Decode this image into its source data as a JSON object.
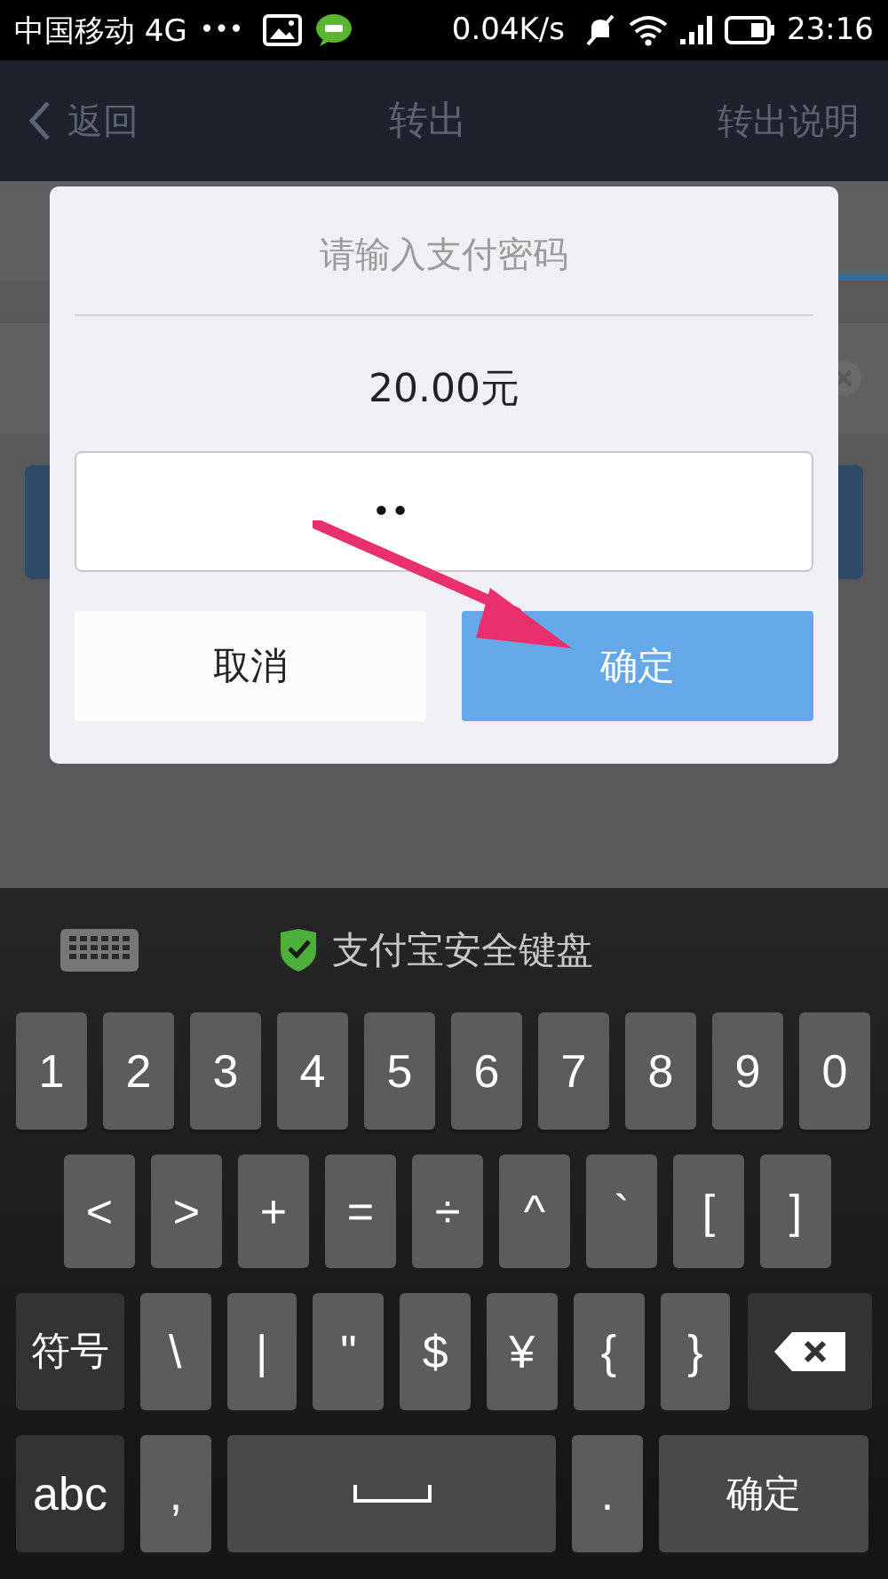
{
  "status_bar": {
    "carrier": "中国移动 4G",
    "more": "•••",
    "speed": "0.04K/s",
    "time": "23:16"
  },
  "nav_bar": {
    "back": "返回",
    "title": "转出",
    "action": "转出说明"
  },
  "dialog": {
    "title": "请输入支付密码",
    "amount": "20.00元",
    "password_field": {
      "value": "••"
    },
    "buttons": [
      {
        "kind": "cancel",
        "label": "取消"
      },
      {
        "kind": "confirm",
        "label": "确定"
      }
    ]
  },
  "keyboard": {
    "title": "支付宝安全键盘",
    "rows": [
      {
        "keys": [
          {
            "kind": "char",
            "label": "1"
          },
          {
            "kind": "char",
            "label": "2"
          },
          {
            "kind": "char",
            "label": "3"
          },
          {
            "kind": "char",
            "label": "4"
          },
          {
            "kind": "char",
            "label": "5"
          },
          {
            "kind": "char",
            "label": "6"
          },
          {
            "kind": "char",
            "label": "7"
          },
          {
            "kind": "char",
            "label": "8"
          },
          {
            "kind": "char",
            "label": "9"
          },
          {
            "kind": "char",
            "label": "0"
          }
        ]
      },
      {
        "keys": [
          {
            "kind": "char",
            "label": "<"
          },
          {
            "kind": "char",
            "label": ">"
          },
          {
            "kind": "char",
            "label": "+"
          },
          {
            "kind": "char",
            "label": "="
          },
          {
            "kind": "char",
            "label": "÷"
          },
          {
            "kind": "char",
            "label": "^"
          },
          {
            "kind": "char",
            "label": "`"
          },
          {
            "kind": "char",
            "label": "["
          },
          {
            "kind": "char",
            "label": "]"
          }
        ]
      },
      {
        "keys": [
          {
            "kind": "special",
            "label": "符号"
          },
          {
            "kind": "char",
            "label": "\\"
          },
          {
            "kind": "char",
            "label": "|"
          },
          {
            "kind": "char",
            "label": "\""
          },
          {
            "kind": "char",
            "label": "$"
          },
          {
            "kind": "char",
            "label": "¥"
          },
          {
            "kind": "char",
            "label": "{"
          },
          {
            "kind": "char",
            "label": "}"
          },
          {
            "kind": "backspace"
          }
        ]
      },
      {
        "keys": [
          {
            "kind": "special",
            "label": "abc"
          },
          {
            "kind": "char",
            "label": ","
          },
          {
            "kind": "space"
          },
          {
            "kind": "char",
            "label": "."
          },
          {
            "kind": "enter",
            "label": "确定"
          }
        ]
      }
    ]
  }
}
